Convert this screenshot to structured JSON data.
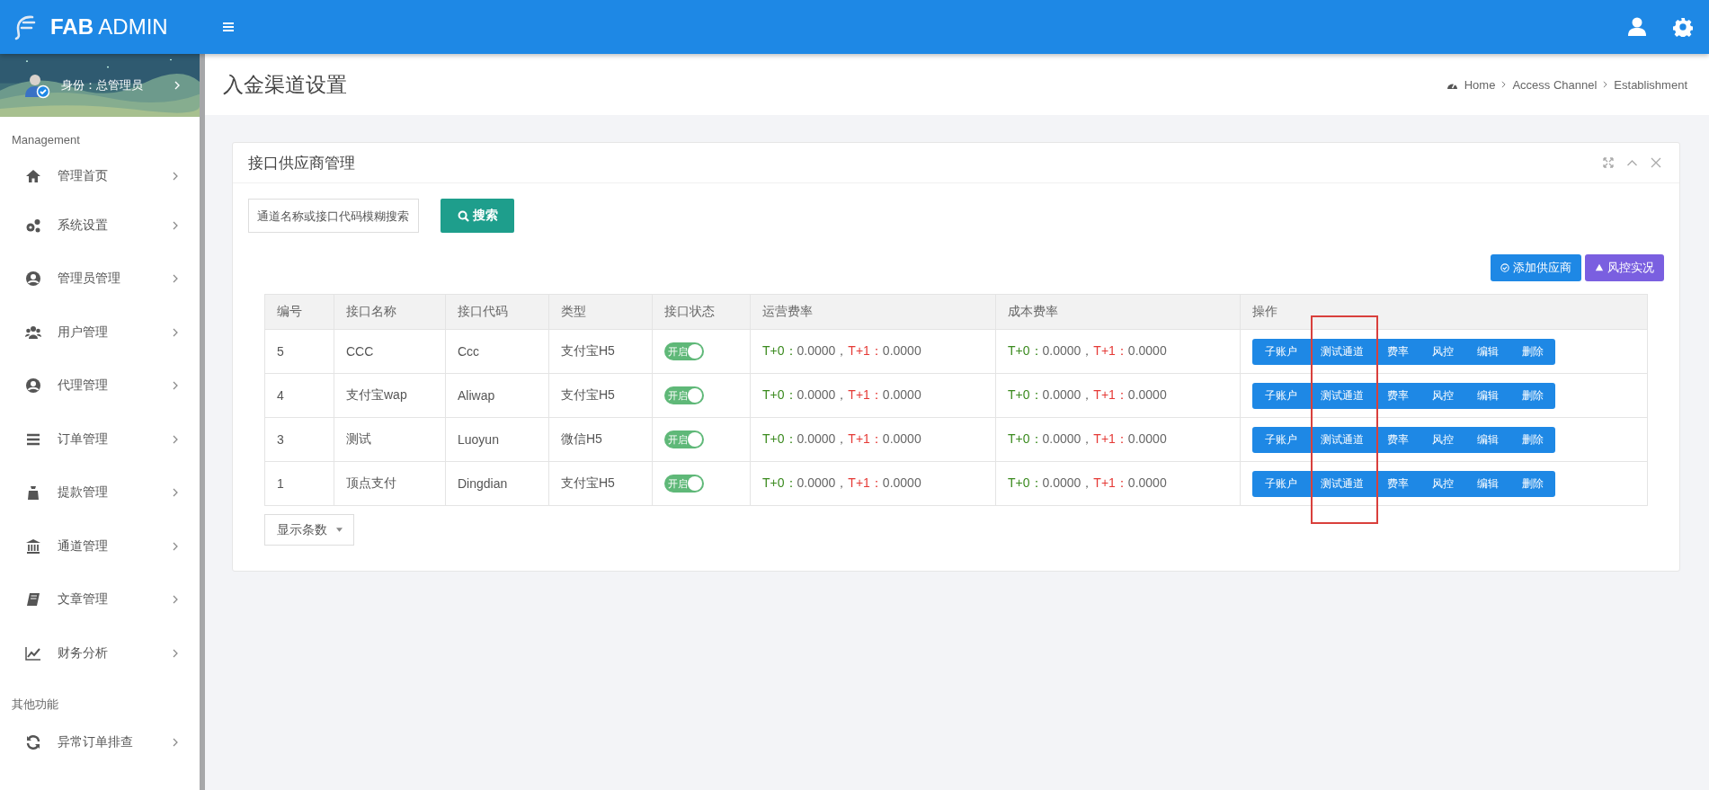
{
  "header": {
    "brand_bold": "FAB",
    "brand_light": "ADMIN"
  },
  "user": {
    "label": "身份：总管理员"
  },
  "sidebar": [
    {
      "heading": "Management",
      "items": [
        {
          "label": "管理首页"
        },
        {
          "label": "系统设置"
        },
        {
          "label": "管理员管理"
        },
        {
          "label": "用户管理"
        },
        {
          "label": "代理管理"
        },
        {
          "label": "订单管理"
        },
        {
          "label": "提款管理"
        },
        {
          "label": "通道管理"
        },
        {
          "label": "文章管理"
        },
        {
          "label": "财务分析"
        }
      ]
    },
    {
      "heading": "其他功能",
      "items": [
        {
          "label": "异常订单排查"
        }
      ]
    }
  ],
  "page": {
    "title": "入金渠道设置",
    "breadcrumb": [
      "Home",
      "Access Channel",
      "Establishment"
    ]
  },
  "card": {
    "title": "接口供应商管理",
    "search": {
      "placeholder": "通道名称或接口代码模糊搜索"
    },
    "search_button": "搜索",
    "actions": [
      {
        "label": "添加供应商",
        "kind": "add"
      },
      {
        "label": "风控实况",
        "kind": "risk"
      }
    ],
    "table": {
      "columns": [
        "编号",
        "接口名称",
        "接口代码",
        "类型",
        "接口状态",
        "运营费率",
        "成本费率",
        "操作"
      ],
      "rows": [
        {
          "id": "5",
          "name": "CCC",
          "code": "Ccc",
          "type": "支付宝H5",
          "status": {
            "label": "开启",
            "on": true
          },
          "op_rate": [
            {
              "kind": "t0",
              "text": "T+0："
            },
            {
              "kind": "value",
              "text": "0.0000，"
            },
            {
              "kind": "t1",
              "text": "T+1："
            },
            {
              "kind": "value",
              "text": "0.0000"
            }
          ],
          "cost_rate": [
            {
              "kind": "t0",
              "text": "T+0："
            },
            {
              "kind": "value",
              "text": "0.0000，"
            },
            {
              "kind": "t1",
              "text": "T+1："
            },
            {
              "kind": "value",
              "text": "0.0000"
            }
          ],
          "actions": [
            "子账户",
            "测试通道",
            "费率",
            "风控",
            "编辑",
            "删除"
          ]
        },
        {
          "id": "4",
          "name": "支付宝wap",
          "code": "Aliwap",
          "type": "支付宝H5",
          "status": {
            "label": "开启",
            "on": true
          },
          "op_rate": [
            {
              "kind": "t0",
              "text": "T+0："
            },
            {
              "kind": "value",
              "text": "0.0000，"
            },
            {
              "kind": "t1",
              "text": "T+1："
            },
            {
              "kind": "value",
              "text": "0.0000"
            }
          ],
          "cost_rate": [
            {
              "kind": "t0",
              "text": "T+0："
            },
            {
              "kind": "value",
              "text": "0.0000，"
            },
            {
              "kind": "t1",
              "text": "T+1："
            },
            {
              "kind": "value",
              "text": "0.0000"
            }
          ],
          "actions": [
            "子账户",
            "测试通道",
            "费率",
            "风控",
            "编辑",
            "删除"
          ]
        },
        {
          "id": "3",
          "name": "测试",
          "code": "Luoyun",
          "type": "微信H5",
          "status": {
            "label": "开启",
            "on": true
          },
          "op_rate": [
            {
              "kind": "t0",
              "text": "T+0："
            },
            {
              "kind": "value",
              "text": "0.0000，"
            },
            {
              "kind": "t1",
              "text": "T+1："
            },
            {
              "kind": "value",
              "text": "0.0000"
            }
          ],
          "cost_rate": [
            {
              "kind": "t0",
              "text": "T+0："
            },
            {
              "kind": "value",
              "text": "0.0000，"
            },
            {
              "kind": "t1",
              "text": "T+1："
            },
            {
              "kind": "value",
              "text": "0.0000"
            }
          ],
          "actions": [
            "子账户",
            "测试通道",
            "费率",
            "风控",
            "编辑",
            "删除"
          ]
        },
        {
          "id": "1",
          "name": "顶点支付",
          "code": "Dingdian",
          "type": "支付宝H5",
          "status": {
            "label": "开启",
            "on": true
          },
          "op_rate": [
            {
              "kind": "t0",
              "text": "T+0："
            },
            {
              "kind": "value",
              "text": "0.0000，"
            },
            {
              "kind": "t1",
              "text": "T+1："
            },
            {
              "kind": "value",
              "text": "0.0000"
            }
          ],
          "cost_rate": [
            {
              "kind": "t0",
              "text": "T+0："
            },
            {
              "kind": "value",
              "text": "0.0000，"
            },
            {
              "kind": "t1",
              "text": "T+1："
            },
            {
              "kind": "value",
              "text": "0.0000"
            }
          ],
          "actions": [
            "子账户",
            "测试通道",
            "费率",
            "风控",
            "编辑",
            "删除"
          ]
        }
      ]
    },
    "page_size_button": "显示条数"
  }
}
